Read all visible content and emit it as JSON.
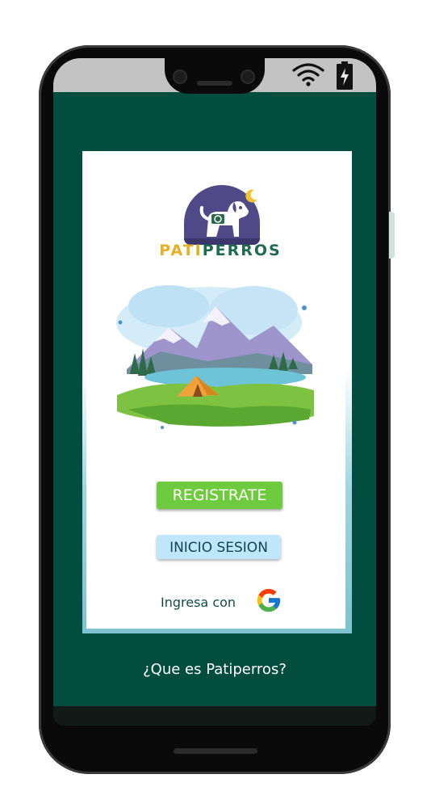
{
  "app": {
    "brand_prefix": "PATI",
    "brand_suffix": "PERROS"
  },
  "actions": {
    "register_label": "REGISTRATE",
    "login_label": "INICIO SESION",
    "google_prompt": "Ingresa con",
    "about_link": "¿Que es Patiperros?"
  },
  "icons": {
    "status": [
      "wifi-icon",
      "battery-charging-icon"
    ],
    "logo": "dog-moon-logo",
    "provider": "google-icon"
  },
  "colors": {
    "background": "#024d3f",
    "register_button": "#6ecb3d",
    "login_button": "#bfe6fb",
    "brand_green": "#1e6b4f",
    "brand_yellow": "#e6b020"
  }
}
